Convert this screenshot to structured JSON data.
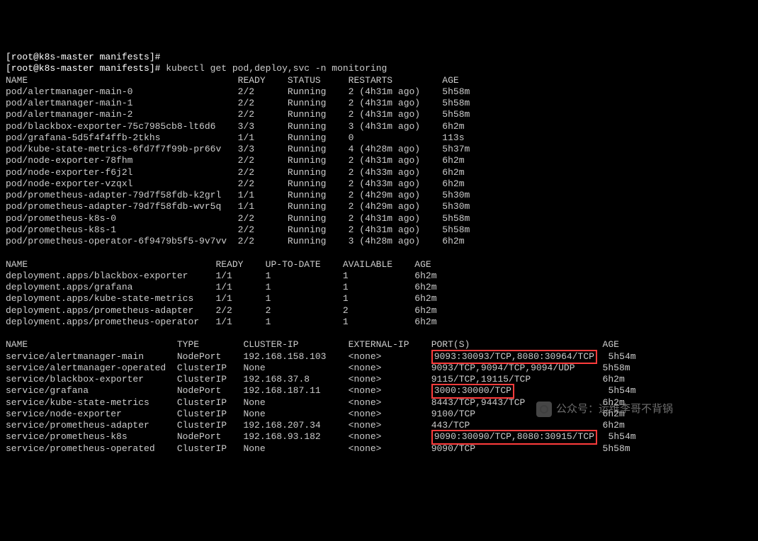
{
  "prompt1": "[root@k8s-master manifests]#",
  "prompt2": "[root@k8s-master manifests]#",
  "command": "kubectl get pod,deploy,svc -n monitoring",
  "pod_header": [
    "NAME",
    "READY",
    "STATUS",
    "RESTARTS",
    "AGE"
  ],
  "pods": [
    {
      "name": "pod/alertmanager-main-0",
      "ready": "2/2",
      "status": "Running",
      "restarts": "2 (4h31m ago)",
      "age": "5h58m"
    },
    {
      "name": "pod/alertmanager-main-1",
      "ready": "2/2",
      "status": "Running",
      "restarts": "2 (4h31m ago)",
      "age": "5h58m"
    },
    {
      "name": "pod/alertmanager-main-2",
      "ready": "2/2",
      "status": "Running",
      "restarts": "2 (4h31m ago)",
      "age": "5h58m"
    },
    {
      "name": "pod/blackbox-exporter-75c7985cb8-lt6d6",
      "ready": "3/3",
      "status": "Running",
      "restarts": "3 (4h31m ago)",
      "age": "6h2m"
    },
    {
      "name": "pod/grafana-5d5f4f4ffb-2tkhs",
      "ready": "1/1",
      "status": "Running",
      "restarts": "0",
      "age": "113s"
    },
    {
      "name": "pod/kube-state-metrics-6fd7f7f99b-pr66v",
      "ready": "3/3",
      "status": "Running",
      "restarts": "4 (4h28m ago)",
      "age": "5h37m"
    },
    {
      "name": "pod/node-exporter-78fhm",
      "ready": "2/2",
      "status": "Running",
      "restarts": "2 (4h31m ago)",
      "age": "6h2m"
    },
    {
      "name": "pod/node-exporter-f6j2l",
      "ready": "2/2",
      "status": "Running",
      "restarts": "2 (4h33m ago)",
      "age": "6h2m"
    },
    {
      "name": "pod/node-exporter-vzqxl",
      "ready": "2/2",
      "status": "Running",
      "restarts": "2 (4h33m ago)",
      "age": "6h2m"
    },
    {
      "name": "pod/prometheus-adapter-79d7f58fdb-k2grl",
      "ready": "1/1",
      "status": "Running",
      "restarts": "2 (4h29m ago)",
      "age": "5h30m"
    },
    {
      "name": "pod/prometheus-adapter-79d7f58fdb-wvr5q",
      "ready": "1/1",
      "status": "Running",
      "restarts": "2 (4h29m ago)",
      "age": "5h30m"
    },
    {
      "name": "pod/prometheus-k8s-0",
      "ready": "2/2",
      "status": "Running",
      "restarts": "2 (4h31m ago)",
      "age": "5h58m"
    },
    {
      "name": "pod/prometheus-k8s-1",
      "ready": "2/2",
      "status": "Running",
      "restarts": "2 (4h31m ago)",
      "age": "5h58m"
    },
    {
      "name": "pod/prometheus-operator-6f9479b5f5-9v7vv",
      "ready": "2/2",
      "status": "Running",
      "restarts": "3 (4h28m ago)",
      "age": "6h2m"
    }
  ],
  "deploy_header": [
    "NAME",
    "READY",
    "UP-TO-DATE",
    "AVAILABLE",
    "AGE"
  ],
  "deploys": [
    {
      "name": "deployment.apps/blackbox-exporter",
      "ready": "1/1",
      "utd": "1",
      "avail": "1",
      "age": "6h2m"
    },
    {
      "name": "deployment.apps/grafana",
      "ready": "1/1",
      "utd": "1",
      "avail": "1",
      "age": "6h2m"
    },
    {
      "name": "deployment.apps/kube-state-metrics",
      "ready": "1/1",
      "utd": "1",
      "avail": "1",
      "age": "6h2m"
    },
    {
      "name": "deployment.apps/prometheus-adapter",
      "ready": "2/2",
      "utd": "2",
      "avail": "2",
      "age": "6h2m"
    },
    {
      "name": "deployment.apps/prometheus-operator",
      "ready": "1/1",
      "utd": "1",
      "avail": "1",
      "age": "6h2m"
    }
  ],
  "svc_header": [
    "NAME",
    "TYPE",
    "CLUSTER-IP",
    "EXTERNAL-IP",
    "PORT(S)",
    "AGE"
  ],
  "svcs": [
    {
      "name": "service/alertmanager-main",
      "type": "NodePort",
      "cip": "192.168.158.103",
      "eip": "<none>",
      "ports": "9093:30093/TCP,8080:30964/TCP",
      "age": "5h54m",
      "box": true
    },
    {
      "name": "service/alertmanager-operated",
      "type": "ClusterIP",
      "cip": "None",
      "eip": "<none>",
      "ports": "9093/TCP,9094/TCP,9094/UDP",
      "age": "5h58m",
      "box": false
    },
    {
      "name": "service/blackbox-exporter",
      "type": "ClusterIP",
      "cip": "192.168.37.8",
      "eip": "<none>",
      "ports": "9115/TCP,19115/TCP",
      "age": "6h2m",
      "box": false
    },
    {
      "name": "service/grafana",
      "type": "NodePort",
      "cip": "192.168.187.11",
      "eip": "<none>",
      "ports": "3000:30000/TCP",
      "age": "5h54m",
      "box": true
    },
    {
      "name": "service/kube-state-metrics",
      "type": "ClusterIP",
      "cip": "None",
      "eip": "<none>",
      "ports": "8443/TCP,9443/TCP",
      "age": "6h2m",
      "box": false
    },
    {
      "name": "service/node-exporter",
      "type": "ClusterIP",
      "cip": "None",
      "eip": "<none>",
      "ports": "9100/TCP",
      "age": "6h2m",
      "box": false
    },
    {
      "name": "service/prometheus-adapter",
      "type": "ClusterIP",
      "cip": "192.168.207.34",
      "eip": "<none>",
      "ports": "443/TCP",
      "age": "6h2m",
      "box": false
    },
    {
      "name": "service/prometheus-k8s",
      "type": "NodePort",
      "cip": "192.168.93.182",
      "eip": "<none>",
      "ports": "9090:30090/TCP,8080:30915/TCP",
      "age": "5h54m",
      "box": true
    },
    {
      "name": "service/prometheus-operated",
      "type": "ClusterIP",
      "cip": "None",
      "eip": "<none>",
      "ports": "9090/TCP",
      "age": "5h58m",
      "box": false
    }
  ],
  "watermark": "公众号：运维李哥不背锅"
}
